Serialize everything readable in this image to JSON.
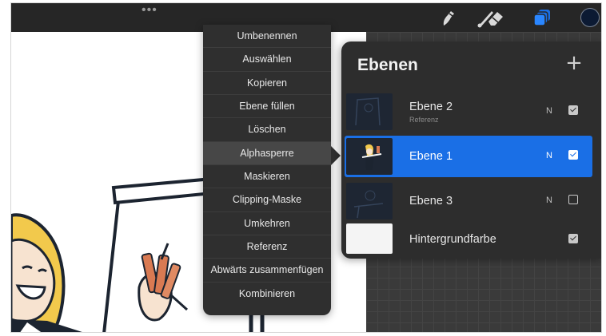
{
  "topbar": {
    "more_label": "•••",
    "tools": [
      {
        "icon": "brush-icon"
      },
      {
        "icon": "smudge-icon"
      },
      {
        "icon": "eraser-icon"
      },
      {
        "icon": "layers-icon",
        "active": true
      }
    ],
    "color_swatch": "#0c1a33"
  },
  "context_menu": {
    "items": [
      "Umbenennen",
      "Auswählen",
      "Kopieren",
      "Ebene füllen",
      "Löschen",
      "Alphasperre",
      "Maskieren",
      "Clipping-Maske",
      "Umkehren",
      "Referenz",
      "Abwärts zusammenfügen",
      "Kombinieren"
    ],
    "active_item": "Alphasperre"
  },
  "layers_panel": {
    "title": "Ebenen",
    "add_label": "+",
    "layers": [
      {
        "name": "Ebene 2",
        "subtitle": "Referenz",
        "blend": "N",
        "visible": true,
        "selected": false
      },
      {
        "name": "Ebene 1",
        "subtitle": "",
        "blend": "N",
        "visible": true,
        "selected": true
      },
      {
        "name": "Ebene 3",
        "subtitle": "",
        "blend": "N",
        "visible": false,
        "selected": false
      },
      {
        "name": "Hintergrundfarbe",
        "subtitle": "",
        "blend": "",
        "visible": true,
        "selected": false
      }
    ]
  },
  "colors": {
    "accent": "#1a6fe6",
    "panel": "#2d2d2d",
    "menu": "#2f2f2f"
  }
}
